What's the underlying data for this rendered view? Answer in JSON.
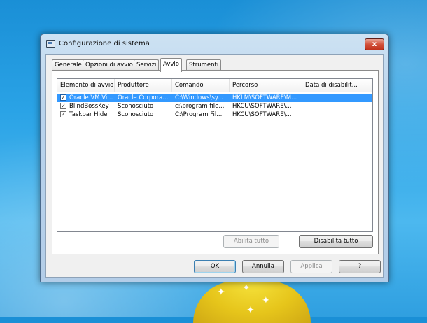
{
  "window": {
    "title": "Configurazione di sistema",
    "close_label": "x"
  },
  "tabs": [
    {
      "label": "Generale",
      "active": false
    },
    {
      "label": "Opzioni di avvio",
      "active": false
    },
    {
      "label": "Servizi",
      "active": false
    },
    {
      "label": "Avvio",
      "active": true
    },
    {
      "label": "Strumenti",
      "active": false
    }
  ],
  "startup_list": {
    "columns": [
      "Elemento di avvio",
      "Produttore",
      "Comando",
      "Percorso",
      "Data di disabilit..."
    ],
    "rows": [
      {
        "checked": true,
        "selected": true,
        "cells": [
          "Oracle VM Vi...",
          "Oracle Corpora...",
          "C:\\Windows\\sy...",
          "HKLM\\SOFTWARE\\M...",
          ""
        ]
      },
      {
        "checked": true,
        "selected": false,
        "cells": [
          "BlindBossKey",
          "Sconosciuto",
          "c:\\program file...",
          "HKCU\\SOFTWARE\\...",
          ""
        ]
      },
      {
        "checked": true,
        "selected": false,
        "cells": [
          "Taskbar Hide",
          "Sconosciuto",
          "C:\\Program Fil...",
          "HKCU\\SOFTWARE\\...",
          ""
        ]
      }
    ]
  },
  "actions": {
    "enable_all": "Abilita tutto",
    "disable_all": "Disabilita tutto"
  },
  "footer": {
    "ok": "OK",
    "cancel": "Annulla",
    "apply": "Applica",
    "help": "?"
  },
  "colors": {
    "selection": "#3399ff",
    "close_button": "#c0321c",
    "desktop": "#2aa3e6"
  }
}
